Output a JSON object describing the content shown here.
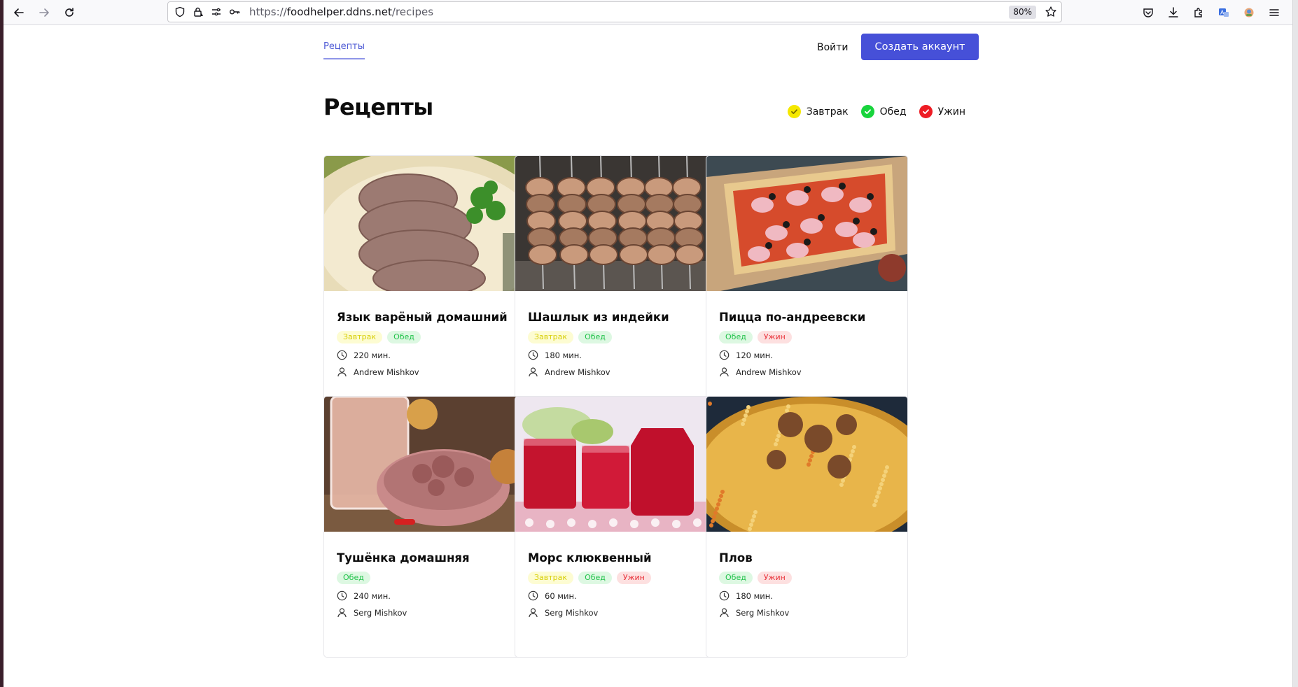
{
  "browser": {
    "url_scheme": "https://",
    "url_host": "foodhelper.ddns.net",
    "url_path": "/recipes",
    "zoom": "80%"
  },
  "nav": {
    "recipes_link": "Рецепты",
    "login": "Войти",
    "signup": "Создать аккаунт"
  },
  "page": {
    "title": "Рецепты"
  },
  "legend": [
    {
      "label": "Завтрак",
      "color": "#f5e800"
    },
    {
      "label": "Обед",
      "color": "#18d43c"
    },
    {
      "label": "Ужин",
      "color": "#ee1c24"
    }
  ],
  "tag_styles": {
    "Завтрак": {
      "bg": "#fdfcd2",
      "fg": "#d8cf0a"
    },
    "Обед": {
      "bg": "#ddf8e2",
      "fg": "#21c24a"
    },
    "Ужин": {
      "bg": "#fde0e0",
      "fg": "#e8323a"
    }
  },
  "recipes": [
    {
      "title": "Язык варёный домашний",
      "tags": [
        "Завтрак",
        "Обед"
      ],
      "time": "220 мин.",
      "author": "Andrew Mishkov",
      "image": "boiled-tongue"
    },
    {
      "title": "Шашлык из индейки",
      "tags": [
        "Завтрак",
        "Обед"
      ],
      "time": "180 мин.",
      "author": "Andrew Mishkov",
      "image": "turkey-kebab"
    },
    {
      "title": "Пицца по-андреевски",
      "tags": [
        "Обед",
        "Ужин"
      ],
      "time": "120 мин.",
      "author": "Andrew Mishkov",
      "image": "pizza"
    },
    {
      "title": "Тушёнка домашняя",
      "tags": [
        "Обед"
      ],
      "time": "240 мин.",
      "author": "Serg Mishkov",
      "image": "stewed-meat"
    },
    {
      "title": "Морс клюквенный",
      "tags": [
        "Завтрак",
        "Обед",
        "Ужин"
      ],
      "time": "60 мин.",
      "author": "Serg Mishkov",
      "image": "cranberry-drink"
    },
    {
      "title": "Плов",
      "tags": [
        "Обед",
        "Ужин"
      ],
      "time": "180 мин.",
      "author": "Serg Mishkov",
      "image": "pilaf"
    }
  ]
}
